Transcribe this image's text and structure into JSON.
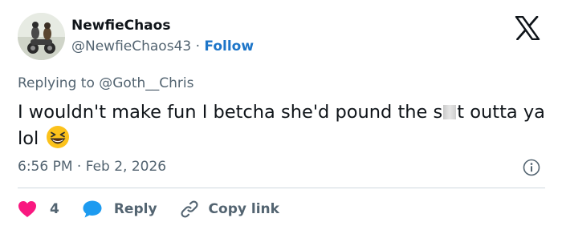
{
  "author": {
    "name": "NewfieChaos",
    "handle": "@NewfieChaos43",
    "separator": "·",
    "follow_label": "Follow",
    "avatar_icon": "motorcycle-avatar"
  },
  "platform_icon": "x-logo-icon",
  "reply": {
    "prefix": "Replying to",
    "target": "@Goth__Chris"
  },
  "tweet": {
    "text_before_censor": "I wouldn't make fun I betcha she'd pound the s",
    "text_after_censor": "t outta ya lol",
    "emoji": "grinning-squinting-face-emoji"
  },
  "meta": {
    "time": "6:56 PM",
    "separator": "·",
    "date": "Feb 2, 2026",
    "info_icon": "info-icon"
  },
  "actions": {
    "like_count": "4",
    "reply_label": "Reply",
    "copy_link_label": "Copy link"
  },
  "colors": {
    "like": "#f91880",
    "reply_bubble": "#1d9bf0",
    "follow": "#1d75c8",
    "secondary_text": "#536471",
    "primary_text": "#0f1419"
  }
}
